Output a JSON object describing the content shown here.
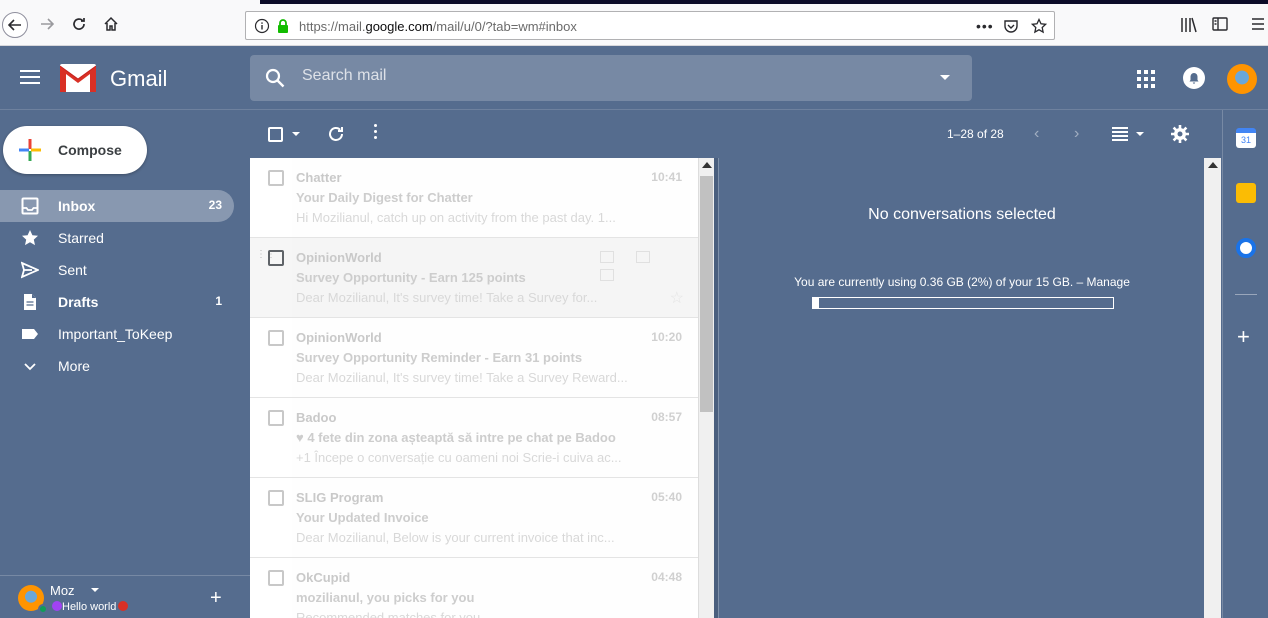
{
  "browser": {
    "url_prefix": "https://mail.",
    "url_domain": "google.com",
    "url_suffix": "/mail/u/0/?tab=wm#inbox"
  },
  "header": {
    "app_name": "Gmail",
    "search_placeholder": "Search mail"
  },
  "sidebar": {
    "compose_label": "Compose",
    "items": [
      {
        "label": "Inbox",
        "count": "23",
        "icon": "inbox-icon"
      },
      {
        "label": "Starred",
        "count": "",
        "icon": "star-icon"
      },
      {
        "label": "Sent",
        "count": "",
        "icon": "send-icon"
      },
      {
        "label": "Drafts",
        "count": "1",
        "icon": "draft-icon"
      },
      {
        "label": "Important_ToKeep",
        "count": "",
        "icon": "label-icon"
      },
      {
        "label": "More",
        "count": "",
        "icon": "chevron-down-icon"
      }
    ],
    "user": {
      "name": "Moz",
      "status": "Hello world"
    }
  },
  "toolbar": {
    "range": "1–28 of 28"
  },
  "mails": [
    {
      "sender": "Chatter",
      "time": "10:41",
      "subject": "Your Daily Digest for Chatter",
      "snippet": "Hi Mozilianul, catch up on activity from the past day. 1..."
    },
    {
      "sender": "OpinionWorld",
      "time": "",
      "subject": "Survey Opportunity - Earn 125 points",
      "snippet": "Dear Mozilianul, It's survey time! Take a Survey for..."
    },
    {
      "sender": "OpinionWorld",
      "time": "10:20",
      "subject": "Survey Opportunity Reminder - Earn 31 points",
      "snippet": "Dear Mozilianul, It's survey time! Take a Survey Reward..."
    },
    {
      "sender": "Badoo",
      "time": "08:57",
      "subject": "♥ 4 fete din zona așteaptă să intre pe chat pe Badoo",
      "snippet": "+1 Începe o conversație cu oameni noi Scrie-i cuiva ac..."
    },
    {
      "sender": "SLIG Program",
      "time": "05:40",
      "subject": "Your Updated Invoice",
      "snippet": "Dear Mozilianul, Below is your current invoice that inc..."
    },
    {
      "sender": "OkCupid",
      "time": "04:48",
      "subject": "mozilianul, you picks for you",
      "snippet": "Recommended matches for you..."
    }
  ],
  "reading_pane": {
    "title": "No conversations selected",
    "usage_text": "You are currently using 0.36 GB (2%) of your 15 GB. – Manage",
    "usage_fraction": 0.02
  },
  "colors": {
    "theme": "#556c8e",
    "side_panel_calendar": "#4285f4",
    "side_panel_keep": "#fbbc04",
    "side_panel_tasks": "#1a73e8"
  }
}
